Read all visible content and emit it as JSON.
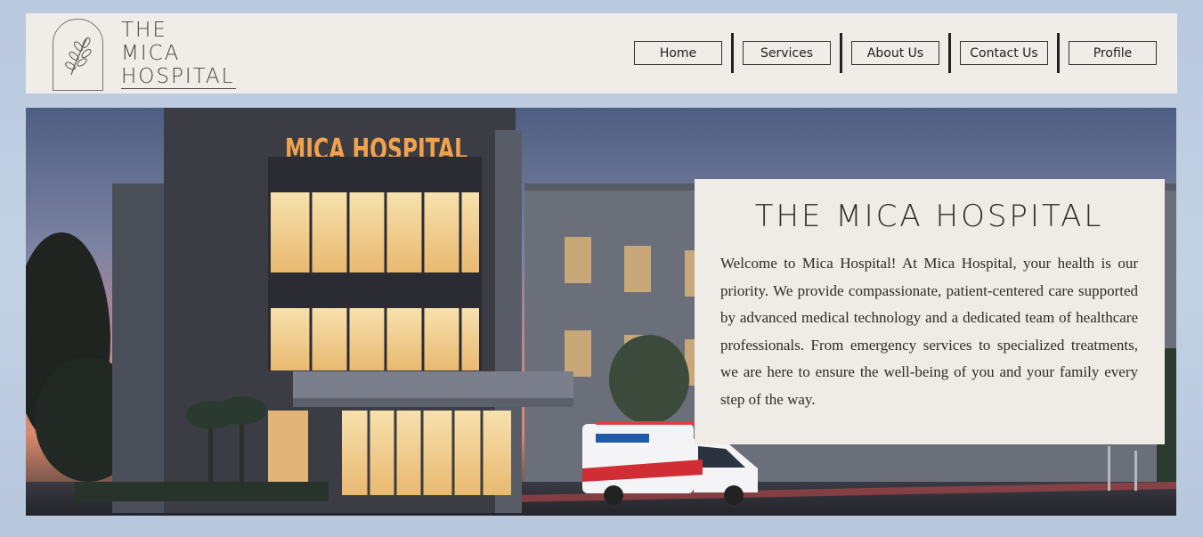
{
  "header": {
    "logo": {
      "line1": "THE",
      "line2": "MICA",
      "line3": "HOSPITAL"
    },
    "nav": [
      {
        "label": "Home"
      },
      {
        "label": "Services"
      },
      {
        "label": "About Us"
      },
      {
        "label": "Contact Us"
      },
      {
        "label": "Profile"
      }
    ]
  },
  "hero": {
    "building_sign": "MICA HOSPITAL",
    "card": {
      "title": "THE MICA HOSPITAL",
      "body": "Welcome to Mica Hospital! At Mica Hospital, your health is our priority. We provide compassionate, patient-centered care supported by advanced medical technology and a dedicated team of healthcare professionals. From emergency services to specialized treatments, we are here to ensure the well-being of you and your family every step of the way."
    }
  },
  "colors": {
    "page_bg": "#bfcde0",
    "header_bg": "#f0ece8",
    "card_bg": "#efebe6",
    "sign_orange": "#f2a24a",
    "window_glow": "#f4d79a"
  }
}
